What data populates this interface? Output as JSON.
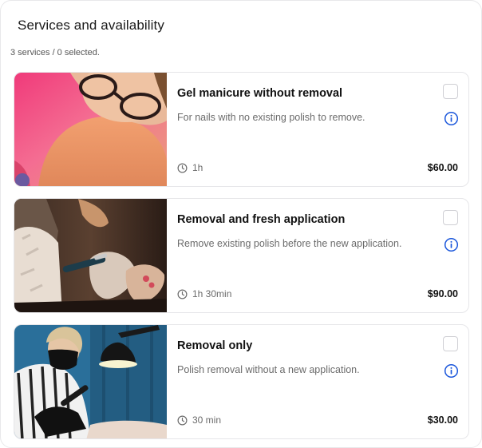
{
  "panel": {
    "title": "Services and availability",
    "summary": "3 services / 0 selected."
  },
  "services": [
    {
      "name": "Gel manicure without removal",
      "description": "For nails with no existing polish to remove.",
      "duration": "1h",
      "price": "$60.00",
      "selected": false,
      "image": "manicurist-close-up-photo"
    },
    {
      "name": "Removal and fresh application",
      "description": "Remove existing polish before the new application.",
      "duration": "1h 30min",
      "price": "$90.00",
      "selected": false,
      "image": "nail-drill-removal-photo"
    },
    {
      "name": "Removal only",
      "description": "Polish removal without a new application.",
      "duration": "30 min",
      "price": "$30.00",
      "selected": false,
      "image": "technician-with-lamp-photo"
    }
  ],
  "icons": {
    "duration": "clock-icon",
    "details": "info-icon"
  },
  "colors": {
    "accent": "#1a56db",
    "border": "#e6e6e9",
    "muted_text": "#6b6b6b"
  }
}
